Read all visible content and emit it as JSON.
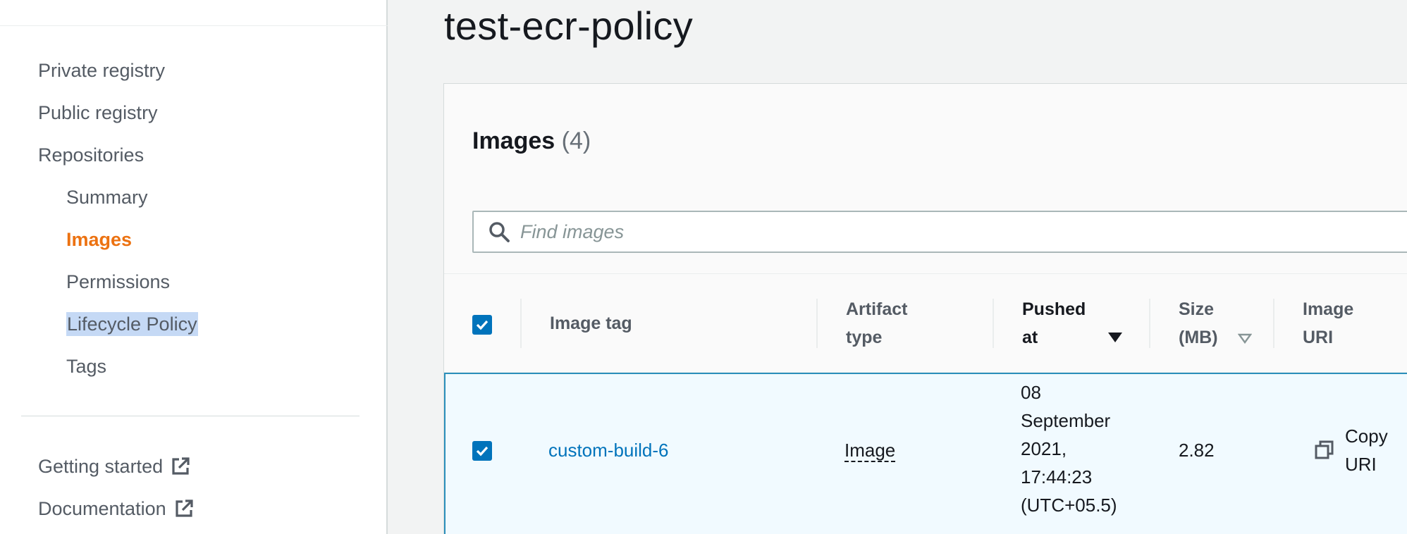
{
  "sidebar": {
    "items": [
      {
        "label": "Private registry"
      },
      {
        "label": "Public registry"
      },
      {
        "label": "Repositories"
      },
      {
        "label": "Summary"
      },
      {
        "label": "Images"
      },
      {
        "label": "Permissions"
      },
      {
        "label": "Lifecycle Policy"
      },
      {
        "label": "Tags"
      }
    ],
    "footer_links": [
      {
        "label": "Getting started",
        "icon": "external-link-icon"
      },
      {
        "label": "Documentation",
        "icon": "external-link-icon"
      }
    ],
    "active_color": "#ec7211",
    "selection_color": "#c5d9f5"
  },
  "page": {
    "title": "test-ecr-policy"
  },
  "images_panel": {
    "title": "Images",
    "count": "(4)",
    "search": {
      "placeholder": "Find images",
      "icon": "search-icon"
    },
    "columns": [
      {
        "label_line1": "Image tag",
        "label_line2": ""
      },
      {
        "label_line1": "Artifact",
        "label_line2": "type"
      },
      {
        "label_line1": "Pushed",
        "label_line2": "at",
        "sort": "descending"
      },
      {
        "label_line1": "Size",
        "label_line2": "(MB)",
        "sort": "sortable"
      },
      {
        "label_line1": "Image",
        "label_line2": "URI"
      }
    ],
    "rows": [
      {
        "selected": true,
        "image_tag": "custom-build-6",
        "artifact_type": "Image",
        "pushed_at": [
          "08",
          "September",
          "2021,",
          "17:44:23",
          "(UTC+05.5)"
        ],
        "size": "2.82",
        "copy_label_line1": "Copy",
        "copy_label_line2": "URI"
      }
    ],
    "header_checkbox_checked": true,
    "accent": "#0073bb"
  }
}
